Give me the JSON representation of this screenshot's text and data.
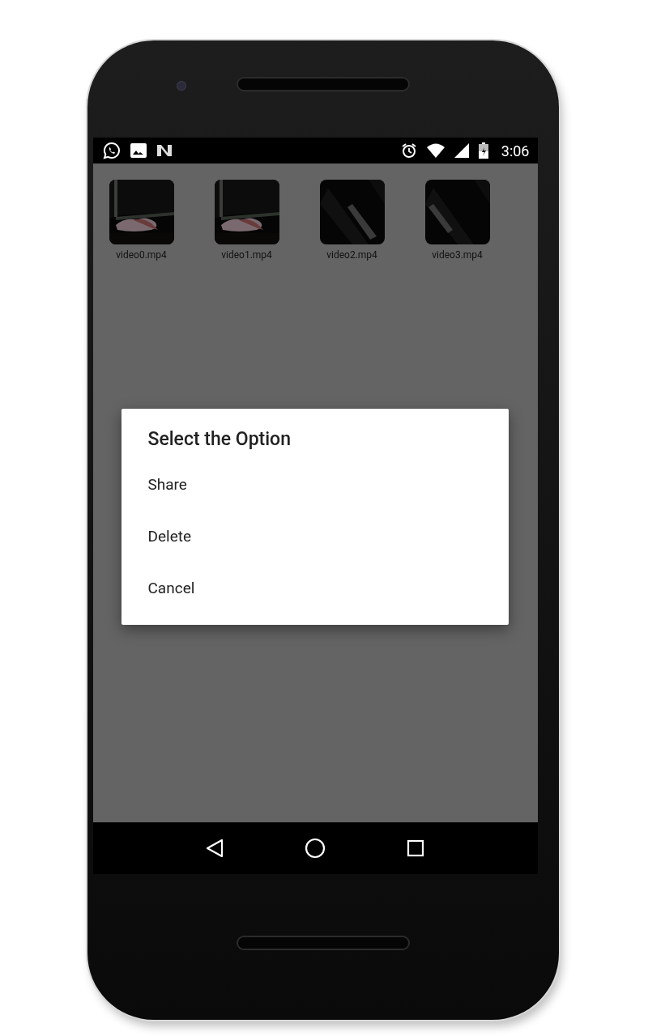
{
  "status_bar": {
    "time": "3:06"
  },
  "videos": [
    {
      "name": "video0.mp4",
      "kind": "picture"
    },
    {
      "name": "video1.mp4",
      "kind": "picture"
    },
    {
      "name": "video2.mp4",
      "kind": "picture"
    },
    {
      "name": "video3.mp4",
      "kind": "picture"
    }
  ],
  "dialog": {
    "title": "Select the Option",
    "options": [
      "Share",
      "Delete",
      "Cancel"
    ]
  }
}
